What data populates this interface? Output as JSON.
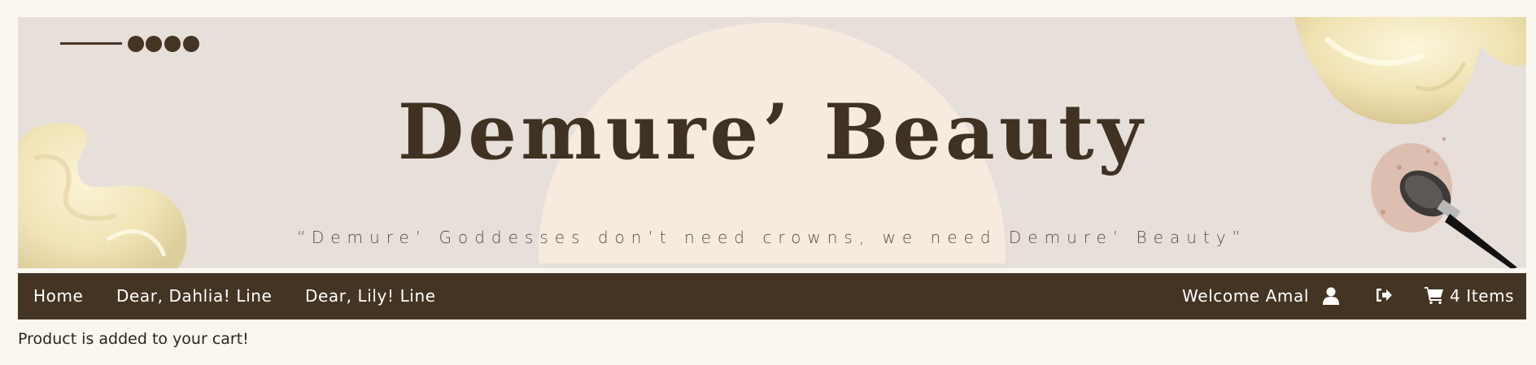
{
  "header": {
    "title": "Demure’ Beauty",
    "tagline": "“Demure’ Goddesses don’t need crowns, we need Demure’ Beauty”"
  },
  "nav": {
    "links": [
      {
        "label": "Home"
      },
      {
        "label": "Dear, Dahlia! Line"
      },
      {
        "label": "Dear, Lily! Line"
      }
    ],
    "welcome": "Welcome Amal",
    "cart_label": "4 Items"
  },
  "message": "Product is added to your cart!",
  "colors": {
    "brand_dark": "#443424",
    "banner_bg": "#e7dfda",
    "arch": "#f6ebde",
    "page_bg": "#faf7f0"
  },
  "icons": [
    "user-icon",
    "logout-icon",
    "cart-icon"
  ]
}
